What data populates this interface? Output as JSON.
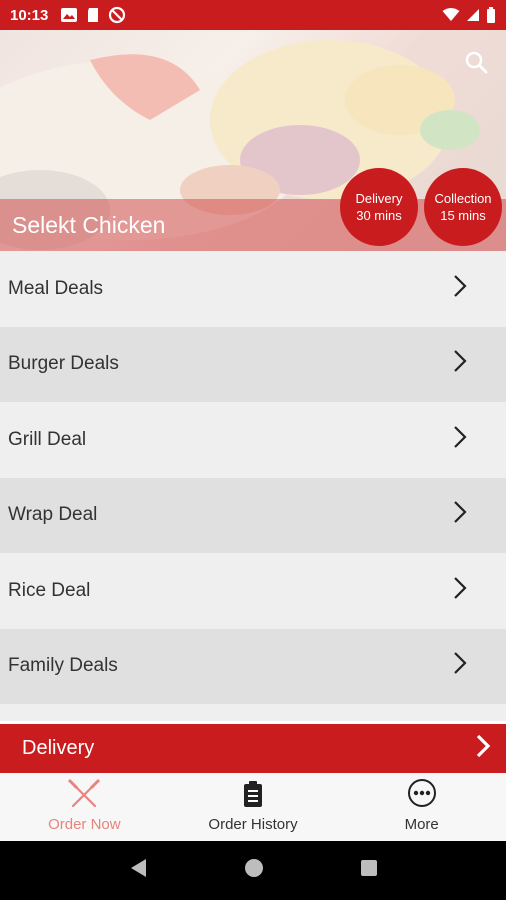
{
  "status_bar": {
    "time": "10:13",
    "icons_left": [
      "gallery-icon",
      "sd-card-icon",
      "dnd-icon"
    ],
    "icons_right": [
      "wifi-icon",
      "signal-icon",
      "battery-icon"
    ]
  },
  "hero": {
    "title": "Selekt Chicken",
    "search_icon": "search-icon",
    "delivery_badge": {
      "line1": "Delivery",
      "line2": "30 mins"
    },
    "collection_badge": {
      "line1": "Collection",
      "line2": "15 mins"
    }
  },
  "menu": {
    "items": [
      {
        "label": "Meal Deals"
      },
      {
        "label": "Burger Deals"
      },
      {
        "label": "Grill Deal"
      },
      {
        "label": "Wrap Deal"
      },
      {
        "label": "Rice Deal"
      },
      {
        "label": "Family Deals"
      }
    ]
  },
  "delivery_bar": {
    "label": "Delivery"
  },
  "bottom_nav": {
    "items": [
      {
        "label": "Order Now",
        "icon": "fork-knife-icon",
        "active": true
      },
      {
        "label": "Order History",
        "icon": "clipboard-icon",
        "active": false
      },
      {
        "label": "More",
        "icon": "more-icon",
        "active": false
      }
    ]
  },
  "colors": {
    "brand_red": "#c91c1e",
    "active_nav": "#e8837d",
    "row_light": "#efefef",
    "row_dark": "#e0e0e0"
  }
}
